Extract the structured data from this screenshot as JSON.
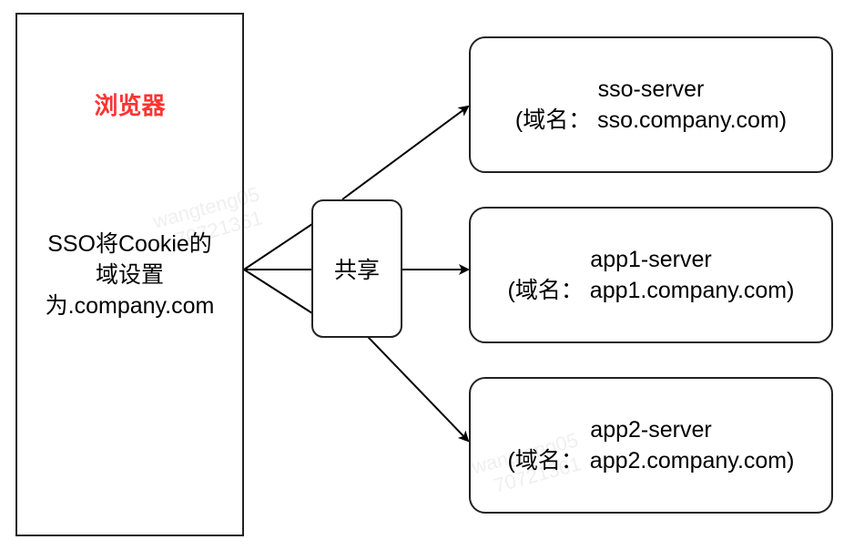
{
  "browser": {
    "title": "浏览器",
    "title_color": "#ff3333",
    "text_lines": [
      "SSO将Cookie的",
      "域设置",
      "为.company.com"
    ]
  },
  "share": {
    "label": "共享"
  },
  "servers": [
    {
      "name": "sso-server",
      "domain": "(域名： sso.company.com)"
    },
    {
      "name": "app1-server",
      "domain": "(域名： app1.company.com)"
    },
    {
      "name": "app2-server",
      "domain": "(域名： app2.company.com)"
    }
  ],
  "watermark": "wangteng05 70721361"
}
